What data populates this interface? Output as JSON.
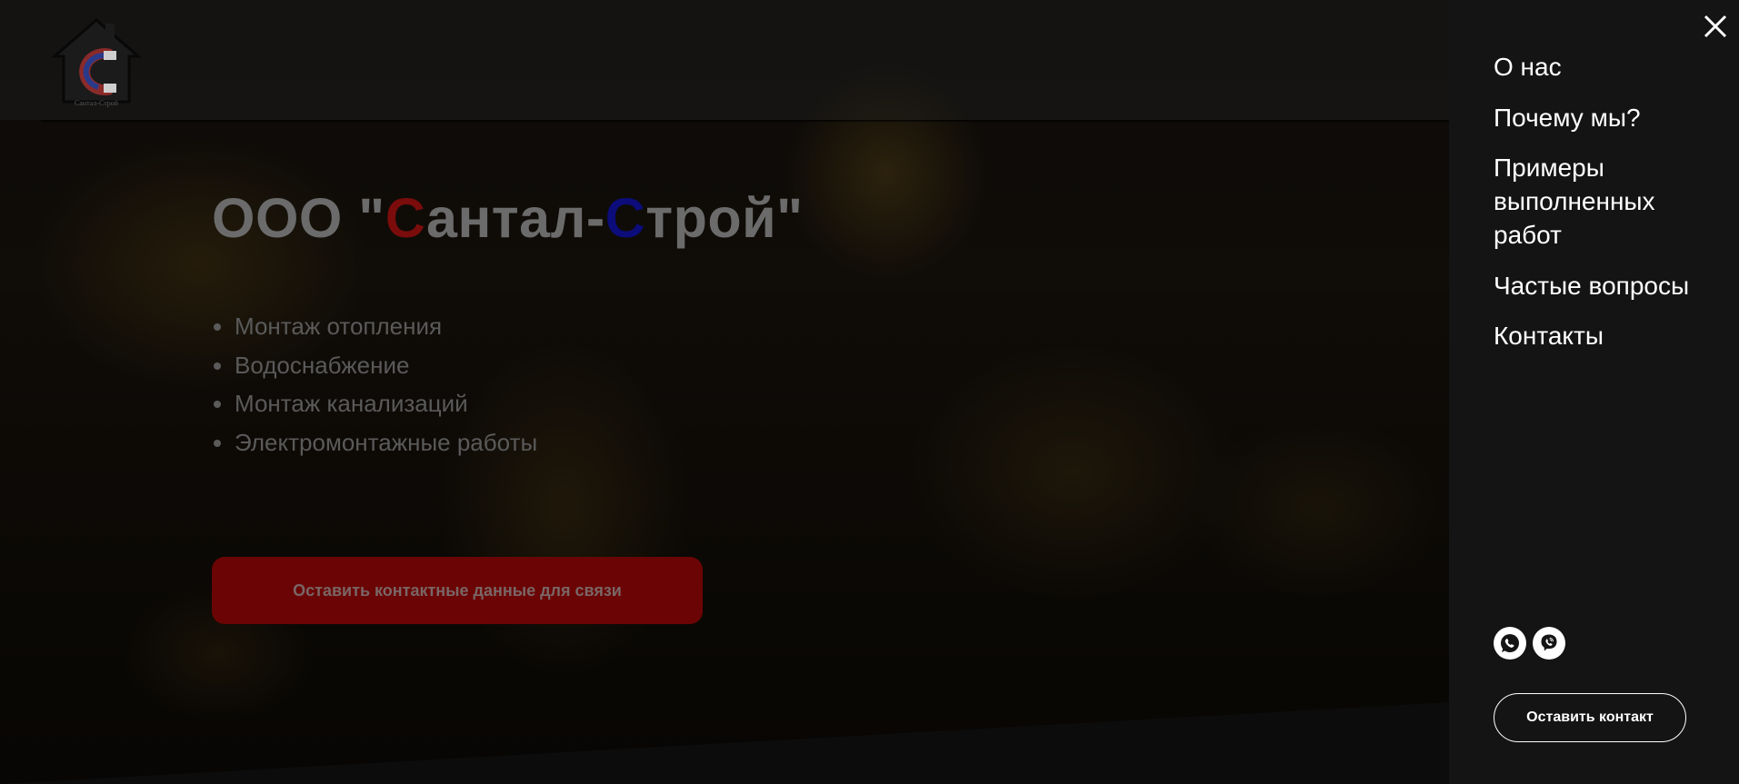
{
  "hero": {
    "title_prefix": "ООО \"",
    "title_c1": "С",
    "title_mid": "антал-",
    "title_c2": "С",
    "title_end": "трой\"",
    "services": [
      "Монтаж отопления",
      "Водоснабжение",
      "Монтаж канализаций",
      "Электромонтажные работы"
    ],
    "cta_label": "Оставить контактные данные для связи"
  },
  "logo": {
    "text": "Сантал-Строй",
    "icon": "house-magnet-logo"
  },
  "menu": {
    "items": [
      "О нас",
      "Почему мы?",
      "Примеры выполненных работ",
      "Частые вопросы",
      "Контакты"
    ],
    "close_icon": "close-icon",
    "social": [
      {
        "icon": "whatsapp-icon"
      },
      {
        "icon": "viber-icon"
      }
    ],
    "contact_button_label": "Оставить контакт"
  },
  "colors": {
    "accent_red": "#7a0c0c",
    "accent_blue": "#0c0c7a",
    "menu_bg": "#141414",
    "cta_bg": "#6b0404"
  }
}
